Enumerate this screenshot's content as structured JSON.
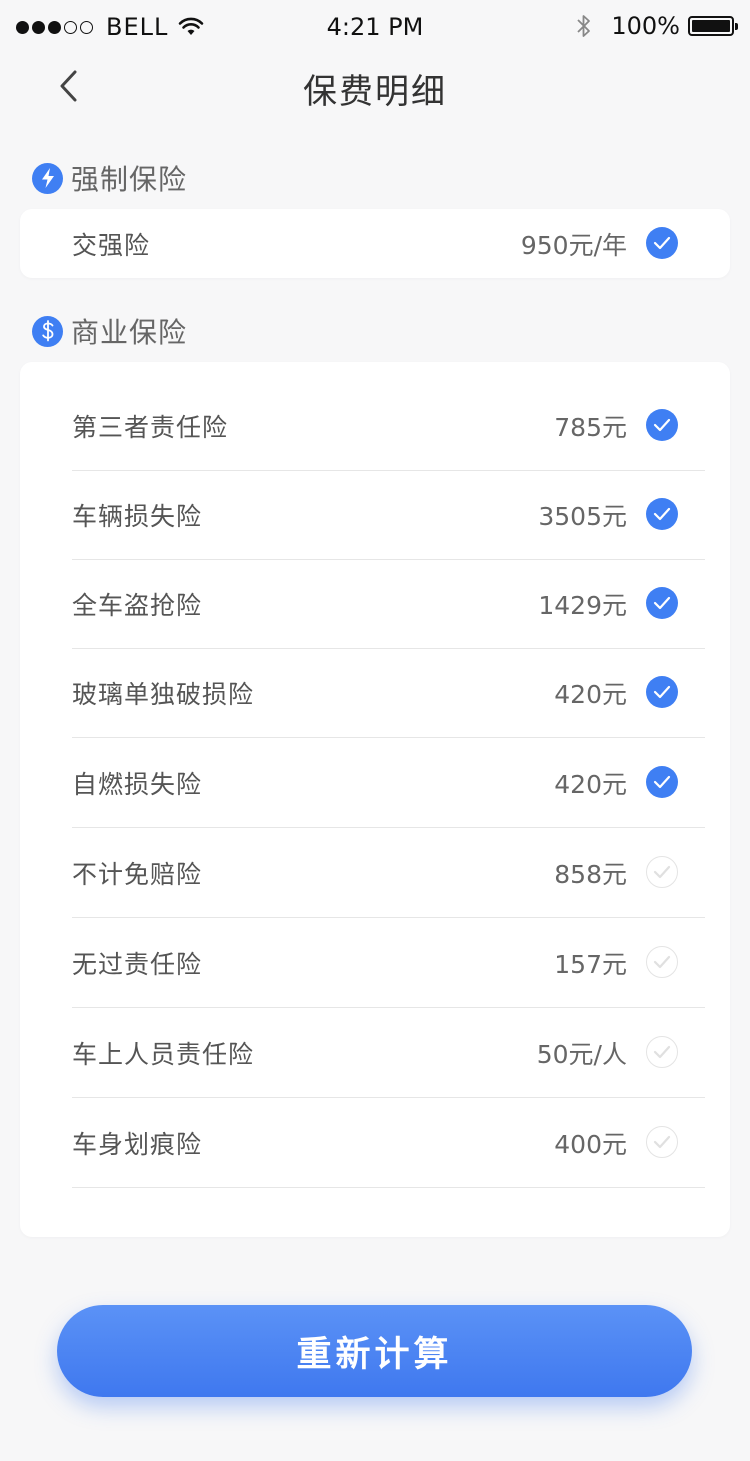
{
  "status_bar": {
    "carrier": "BELL",
    "time": "4:21 PM",
    "battery": "100%",
    "signal_dots_filled": 3,
    "signal_dots_total": 5,
    "battery_level": 1.0
  },
  "nav": {
    "title": "保费明细",
    "back_icon": "chevron-left-icon"
  },
  "colors": {
    "accent": "#3f7ff3",
    "background": "#f7f7f8",
    "card": "#ffffff"
  },
  "compulsory": {
    "title": "强制保险",
    "icon": "lightning-icon",
    "items": [
      {
        "name": "交强险",
        "price": "950元/年",
        "checked": true
      }
    ]
  },
  "commercial": {
    "title": "商业保险",
    "icon": "dollar-icon",
    "items": [
      {
        "name": "第三者责任险",
        "price": "785元",
        "checked": true
      },
      {
        "name": "车辆损失险",
        "price": "3505元",
        "checked": true
      },
      {
        "name": "全车盗抢险",
        "price": "1429元",
        "checked": true
      },
      {
        "name": "玻璃单独破损险",
        "price": "420元",
        "checked": true
      },
      {
        "name": "自燃损失险",
        "price": "420元",
        "checked": true
      },
      {
        "name": "不计免赔险",
        "price": "858元",
        "checked": false
      },
      {
        "name": "无过责任险",
        "price": "157元",
        "checked": false
      },
      {
        "name": "车上人员责任险",
        "price": "50元/人",
        "checked": false
      },
      {
        "name": "车身划痕险",
        "price": "400元",
        "checked": false
      }
    ]
  },
  "actions": {
    "recalculate_label": "重新计算"
  }
}
